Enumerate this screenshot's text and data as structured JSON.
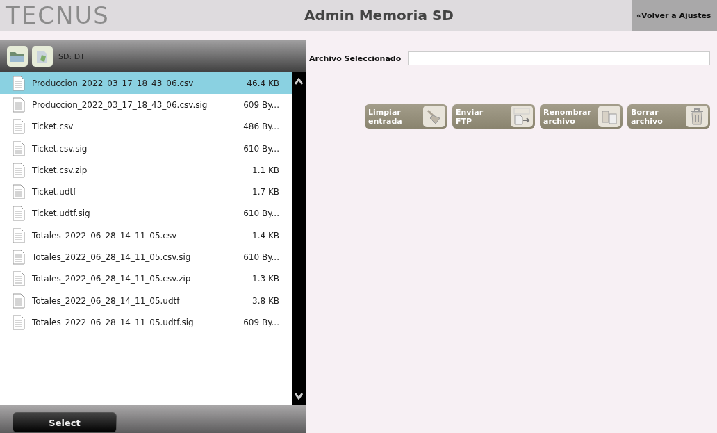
{
  "header": {
    "logo": "TECNUS",
    "title": "Admin Memoria SD",
    "back_button": "«Volver a Ajustes"
  },
  "file_panel": {
    "path": "SD: DT",
    "files": [
      {
        "name": "Produccion_2022_03_17_18_43_06.csv",
        "size": "46.4 KB",
        "selected": true
      },
      {
        "name": "Produccion_2022_03_17_18_43_06.csv.sig",
        "size": "609 By...",
        "selected": false
      },
      {
        "name": "Ticket.csv",
        "size": "486 By...",
        "selected": false
      },
      {
        "name": "Ticket.csv.sig",
        "size": "610 By...",
        "selected": false
      },
      {
        "name": "Ticket.csv.zip",
        "size": "1.1 KB",
        "selected": false
      },
      {
        "name": "Ticket.udtf",
        "size": "1.7 KB",
        "selected": false
      },
      {
        "name": "Ticket.udtf.sig",
        "size": "610 By...",
        "selected": false
      },
      {
        "name": "Totales_2022_06_28_14_11_05.csv",
        "size": "1.4 KB",
        "selected": false
      },
      {
        "name": "Totales_2022_06_28_14_11_05.csv.sig",
        "size": "610 By...",
        "selected": false
      },
      {
        "name": "Totales_2022_06_28_14_11_05.csv.zip",
        "size": "1.3 KB",
        "selected": false
      },
      {
        "name": "Totales_2022_06_28_14_11_05.udtf",
        "size": "3.8 KB",
        "selected": false
      },
      {
        "name": "Totales_2022_06_28_14_11_05.udtf.sig",
        "size": "609 By...",
        "selected": false
      }
    ],
    "select_button": "Select"
  },
  "selected_file": {
    "label": "Archivo Seleccionado"
  },
  "actions": [
    {
      "kind": "clear",
      "line1": "Limpiar",
      "line2": "entrada",
      "disabled": true
    },
    {
      "kind": "ftp",
      "line1": "Enviar",
      "line2": "FTP",
      "disabled": true
    },
    {
      "kind": "rename",
      "line1": "Renombrar",
      "line2": "archivo",
      "disabled": true
    },
    {
      "kind": "delete",
      "line1": "Borrar",
      "line2": "archivo",
      "disabled": true
    }
  ]
}
